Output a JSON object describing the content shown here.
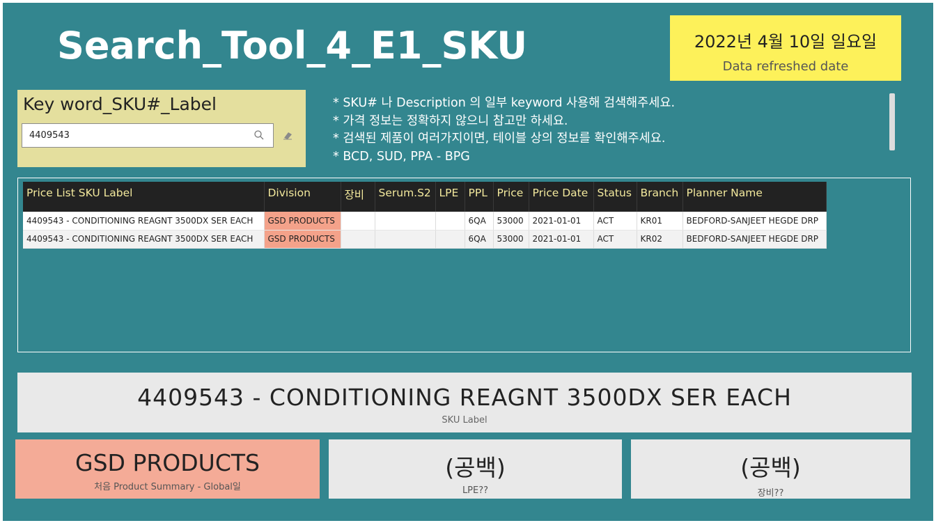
{
  "header": {
    "title": "Search_Tool_4_E1_SKU",
    "date_value": "2022년 4월 10일 일요일",
    "date_caption": "Data refreshed date"
  },
  "slicer": {
    "title": "Key word_SKU#_Label",
    "search_value": "4409543",
    "icons": [
      "search-icon",
      "eraser-icon"
    ]
  },
  "notes": [
    "* SKU# 나 Description 의 일부 keyword 사용해 검색해주세요.",
    "* 가격 정보는 정확하지 않으니 참고만 하세요.",
    "* 검색된 제품이 여러가지이면, 테이블 상의 정보를 확인해주세요.",
    "* BCD, SUD, PPA - BPG"
  ],
  "table": {
    "columns": [
      "Price List SKU Label",
      "Division",
      "장비",
      "Serum.S2",
      "LPE",
      "PPL",
      "Price",
      "Price Date",
      "Status",
      "Branch",
      "Planner Name"
    ],
    "rows": [
      [
        "4409543 - CONDITIONING REAGNT 3500DX SER EACH",
        "GSD PRODUCTS",
        "",
        "",
        "",
        "6QA",
        "53000",
        "2021-01-01",
        "ACT",
        "KR01",
        "BEDFORD-SANJEET HEGDE DRP"
      ],
      [
        "4409543 - CONDITIONING REAGNT 3500DX SER EACH",
        "GSD PRODUCTS",
        "",
        "",
        "",
        "6QA",
        "53000",
        "2021-01-01",
        "ACT",
        "KR02",
        "BEDFORD-SANJEET HEGDE DRP"
      ]
    ]
  },
  "sku_card": {
    "value": "4409543 - CONDITIONING REAGNT 3500DX SER EACH",
    "caption": "SKU Label"
  },
  "kpi_division": {
    "value": "GSD PRODUCTS",
    "caption": "처음 Product Summary - Global일"
  },
  "kpi_lpe": {
    "value": "(공백)",
    "caption": "LPE??"
  },
  "kpi_equip": {
    "value": "(공백)",
    "caption": "장비??"
  },
  "colors": {
    "background": "#33868f",
    "date_card": "#fdf15a",
    "slicer": "#e4df9e",
    "division_highlight": "#f4a28a",
    "table_header": "#222222",
    "table_header_text": "#f3e99d"
  }
}
